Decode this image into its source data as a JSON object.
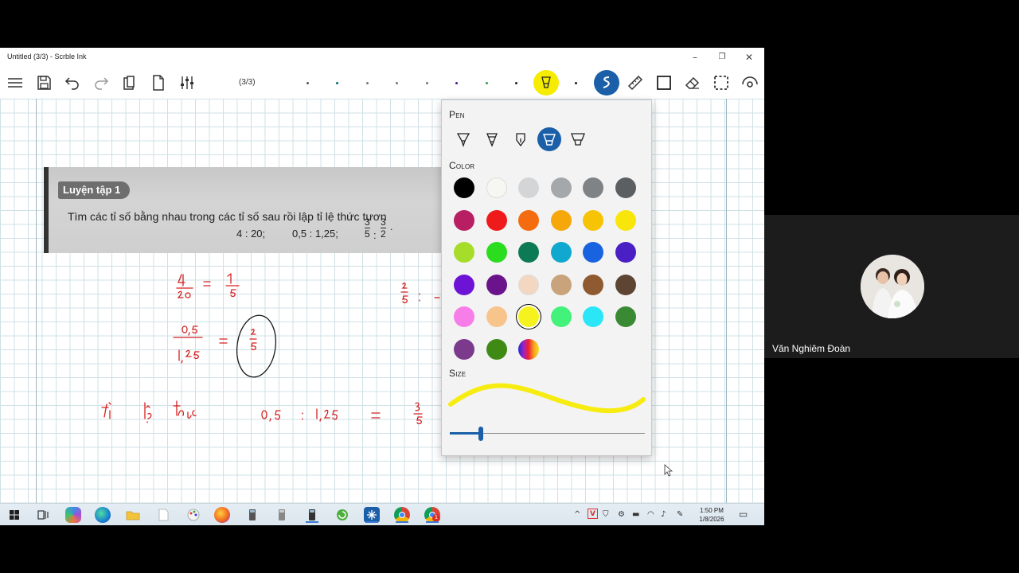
{
  "window": {
    "title": "Untitled (3/3) - Scrble Ink",
    "min_icon": "minimize-icon",
    "max_icon": "restore-icon",
    "close_icon": "close-icon"
  },
  "toolbar": {
    "page_indicator": "(3/3)",
    "icons": [
      "menu-icon",
      "save-icon",
      "undo-icon",
      "redo-icon",
      "paste-icon",
      "new-page-icon",
      "settings-sliders-icon",
      "highlighter-icon",
      "scribble-pen-icon",
      "ruler-icon",
      "shape-icon",
      "eraser-icon",
      "lasso-select-icon",
      "view-icon"
    ],
    "color_dots": [
      "#555555",
      "#0a6b6b",
      "#777777",
      "#777777",
      "#777777",
      "#4a1a8a",
      "#2ea03a",
      "#222222"
    ],
    "active_highlighter_color": "#f5ec00",
    "active_pen_color": "#1b5fa8"
  },
  "exercise": {
    "badge": "Luyện tập 1",
    "instruction": "Tìm các tỉ số bằng nhau trong các tỉ số sau rồi lập tỉ lệ thức tươn",
    "ratio1": "4 : 20;",
    "ratio2": "0,5 : 1,25;",
    "frac1_num": "3",
    "frac1_den": "5",
    "sep": ":",
    "frac2_num": "3",
    "frac2_den": "2",
    "frac2_tail": "."
  },
  "flyout": {
    "pen_heading": "Pen",
    "color_heading": "Color",
    "size_heading": "Size",
    "pen_icons": [
      "ballpoint-pen-icon",
      "pencil-pen-icon",
      "fountain-pen-icon",
      "highlighter-pen-icon",
      "calligraphy-pen-icon"
    ],
    "selected_pen_index": 3,
    "colors": [
      [
        "#000000",
        "#f6f6f2",
        "#d3d5d6",
        "#a5a8aa",
        "#808386",
        "#5c5f61"
      ],
      [
        "#b81f62",
        "#ef1a1a",
        "#f56b10",
        "#f6a80a",
        "#f7c405",
        "#f8e60a"
      ],
      [
        "#a6dd2a",
        "#2bdc1f",
        "#0b7a55",
        "#10a8cf",
        "#1763e0",
        "#4a1fc4"
      ],
      [
        "#6c13d6",
        "#6b138a",
        "#f3d7c1",
        "#c9a37b",
        "#8f5a2f",
        "#5e4533"
      ],
      [
        "#f77ee8",
        "#f7c48c",
        "#f6f21d",
        "#43f27a",
        "#2be6f7",
        "#3a8a33"
      ],
      [
        "#7c3a8c",
        "#3f8a15"
      ]
    ],
    "selected_color": "#f6f21d",
    "size_value": 0.16,
    "stroke_color": "#f7ec10"
  },
  "taskbar": {
    "icons": [
      "windows-start-icon",
      "task-view-icon",
      "copilot-icon",
      "edge-icon",
      "file-explorer-icon",
      "notepad-icon",
      "paint-icon",
      "firefox-icon",
      "calculator-icon",
      "calculator-alt-icon",
      "calculator-active-icon",
      "refresh-app-icon",
      "snipping-tool-icon",
      "chrome-icon",
      "chrome-profile-icon"
    ],
    "chrome_badge": "1",
    "clock_time": "1:50 PM",
    "clock_date": "1/8/2026",
    "tray_icons": [
      "chevron-up-icon",
      "vietkey-icon",
      "defender-icon",
      "network-icon",
      "battery-icon",
      "wifi-icon",
      "volume-icon",
      "pen-tray-icon",
      "notification-icon"
    ],
    "vietkey_label": "V"
  },
  "participant": {
    "name": "Văn Nghiêm Đoàn"
  }
}
